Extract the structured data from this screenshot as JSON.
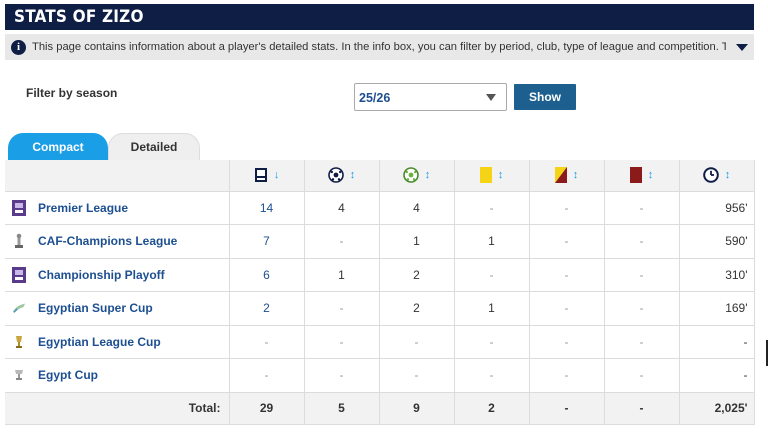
{
  "header": {
    "title": "STATS OF ZIZO",
    "info_text": "This page contains information about a player's detailed stats. In the info box, you can filter by period, club, type of league and competition. Th..."
  },
  "filter": {
    "label": "Filter by season",
    "season_value": "25/26",
    "show_label": "Show"
  },
  "tabs": [
    {
      "label": "Compact",
      "active": true
    },
    {
      "label": "Detailed",
      "active": false
    }
  ],
  "columns": [
    {
      "icon": "appearances-icon",
      "sort": "↓"
    },
    {
      "icon": "goals-icon",
      "sort": "↕"
    },
    {
      "icon": "assists-icon",
      "sort": "↕"
    },
    {
      "icon": "yellow-card-icon",
      "sort": "↕"
    },
    {
      "icon": "second-yellow-card-icon",
      "sort": "↕"
    },
    {
      "icon": "red-card-icon",
      "sort": "↕"
    },
    {
      "icon": "minutes-clock-icon",
      "sort": "↕"
    }
  ],
  "rows": [
    {
      "competition": "Premier League",
      "logo": "premier-league-logo-icon",
      "apps": "14",
      "goals": "4",
      "assists": "4",
      "yellow": "-",
      "second_yellow": "-",
      "red": "-",
      "minutes": "956'"
    },
    {
      "competition": "CAF-Champions League",
      "logo": "caf-champions-league-logo-icon",
      "apps": "7",
      "goals": "-",
      "assists": "1",
      "yellow": "1",
      "second_yellow": "-",
      "red": "-",
      "minutes": "590'"
    },
    {
      "competition": "Championship Playoff",
      "logo": "championship-playoff-logo-icon",
      "apps": "6",
      "goals": "1",
      "assists": "2",
      "yellow": "-",
      "second_yellow": "-",
      "red": "-",
      "minutes": "310'"
    },
    {
      "competition": "Egyptian Super Cup",
      "logo": "egyptian-super-cup-logo-icon",
      "apps": "2",
      "goals": "-",
      "assists": "2",
      "yellow": "1",
      "second_yellow": "-",
      "red": "-",
      "minutes": "169'"
    },
    {
      "competition": "Egyptian League Cup",
      "logo": "egyptian-league-cup-logo-icon",
      "apps": "-",
      "goals": "-",
      "assists": "-",
      "yellow": "-",
      "second_yellow": "-",
      "red": "-",
      "minutes": "-"
    },
    {
      "competition": "Egypt Cup",
      "logo": "egypt-cup-logo-icon",
      "apps": "-",
      "goals": "-",
      "assists": "-",
      "yellow": "-",
      "second_yellow": "-",
      "red": "-",
      "minutes": "-"
    }
  ],
  "totals": {
    "label": "Total:",
    "apps": "29",
    "goals": "5",
    "assists": "9",
    "yellow": "2",
    "second_yellow": "-",
    "red": "-",
    "minutes": "2,025'"
  },
  "colors": {
    "title_bg": "#0e1e44",
    "accent_blue": "#1a9ee6",
    "link_blue": "#1d4f91",
    "button_blue": "#1d5f8f",
    "yellow_card": "#f5d316",
    "red_card": "#8b1a1a"
  }
}
